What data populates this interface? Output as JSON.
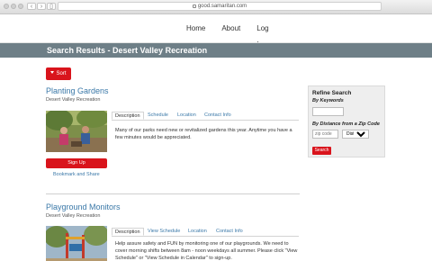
{
  "browser": {
    "url": "good.samaritan.com"
  },
  "nav": {
    "home": "Home",
    "about": "About",
    "login": "Log In"
  },
  "header": {
    "title": "Search Results - Desert Valley Recreation"
  },
  "sort": {
    "label": "Sort"
  },
  "listings": [
    {
      "title": "Planting Gardens",
      "org": "Desert Valley Recreation",
      "tabs": [
        "Description",
        "Schedule",
        "Location",
        "Contact Info"
      ],
      "description": "Many of our parks need new or revitalized gardens this year. Anytime you have a few minutes would be appreciated.",
      "signup": "Sign Up",
      "bookmark": "Bookmark and Share"
    },
    {
      "title": "Playground Monitors",
      "org": "Desert Valley Recreation",
      "tabs": [
        "Description",
        "View Schedule",
        "Location",
        "Contact Info"
      ],
      "description": "Help assure safety and FUN by monitoring one of our playgrounds. We need to cover morning shifts between 8am - noon weekdays all summer. Please click \"View Schedule\" or \"View Schedule in Calendar\" to sign-up."
    }
  ],
  "refine": {
    "title": "Refine Search",
    "keywords_label": "By Keywords",
    "zip_label": "By Distance from a Zip Code",
    "zip_placeholder": "zip code",
    "distance_selected": "Distance",
    "search_button": "Search"
  }
}
